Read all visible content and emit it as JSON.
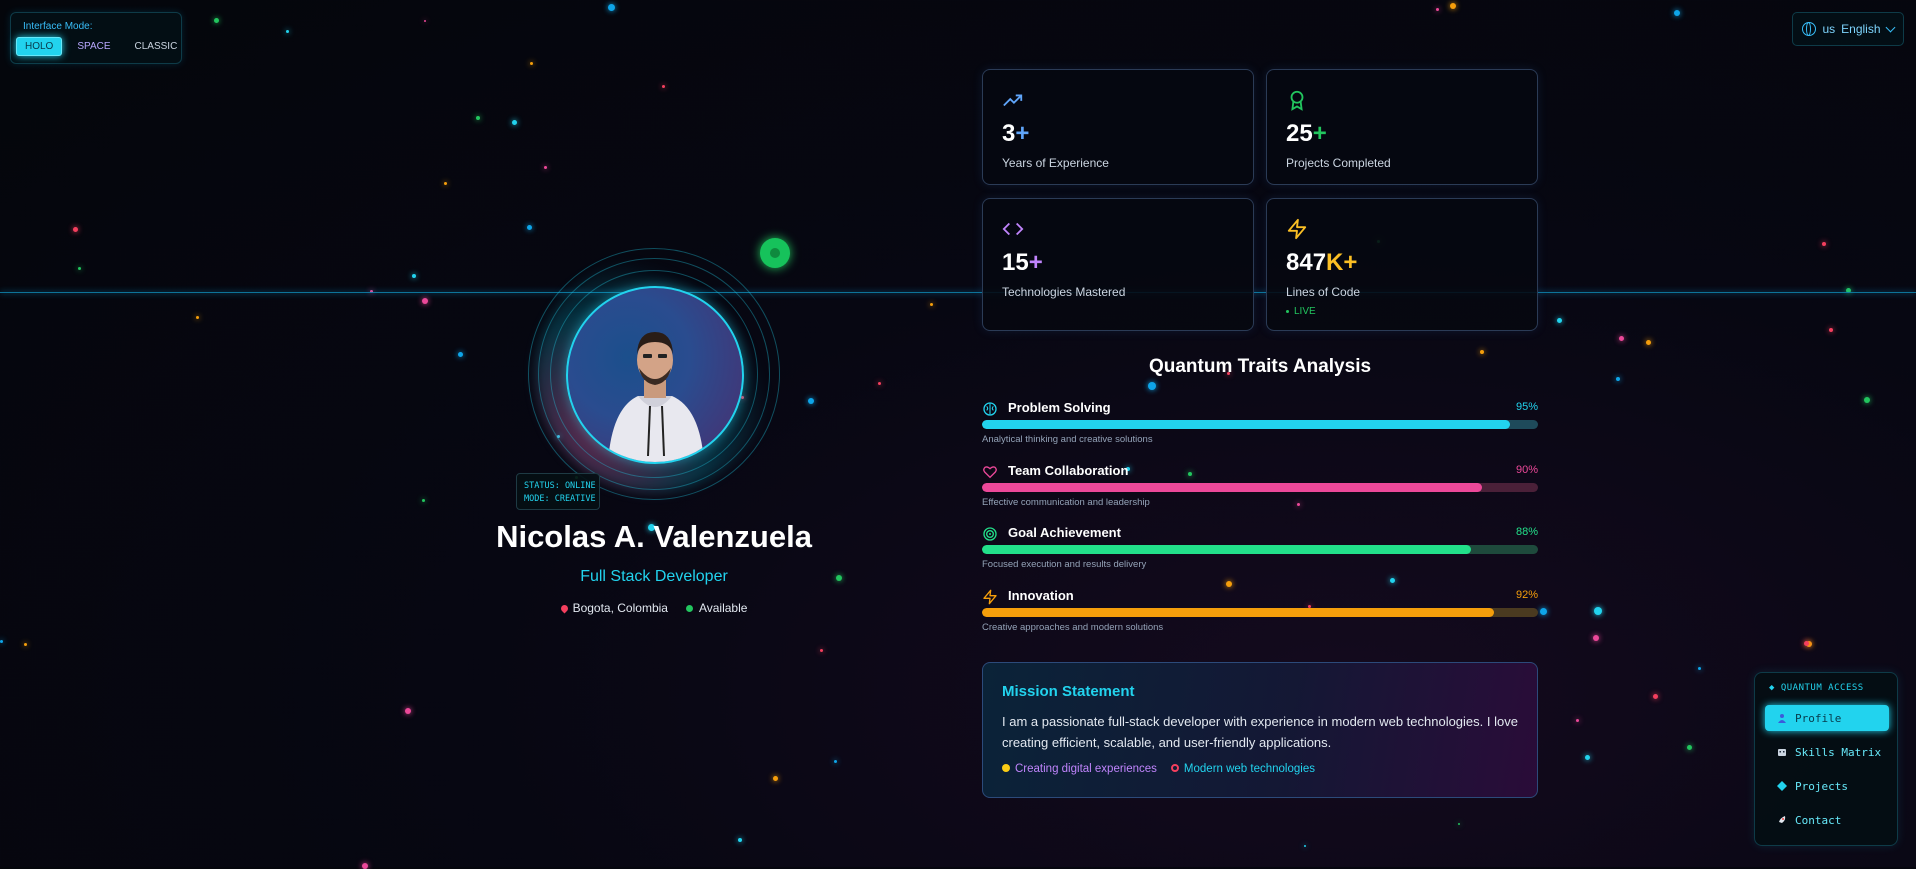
{
  "mode_switch": {
    "title": "Interface Mode:",
    "options": [
      "HOLO",
      "SPACE",
      "CLASSIC"
    ],
    "active": "HOLO"
  },
  "language": {
    "flag": "us",
    "label": "English",
    "icon": "globe-icon"
  },
  "profile": {
    "status_line1": "STATUS: ONLINE",
    "status_line2": "MODE: CREATIVE",
    "name": "Nicolas A. Valenzuela",
    "role": "Full Stack Developer",
    "location": "Bogota, Colombia",
    "availability": "Available"
  },
  "stats": [
    {
      "value": "3",
      "suffix": "+",
      "label": "Years of Experience",
      "icon": "trending-up-icon",
      "color": "#60a5fa"
    },
    {
      "value": "25",
      "suffix": "+",
      "label": "Projects Completed",
      "icon": "award-icon",
      "color": "#22c55e"
    },
    {
      "value": "15",
      "suffix": "+",
      "label": "Technologies Mastered",
      "icon": "code-icon",
      "color": "#c084fc"
    },
    {
      "value": "847",
      "suffix": "K+",
      "label": "Lines of Code",
      "icon": "zap-icon",
      "color": "#fbbf24",
      "live": "LIVE"
    }
  ],
  "traits": {
    "title": "Quantum Traits Analysis",
    "items": [
      {
        "name": "Problem Solving",
        "percent": 95,
        "percent_label": "95%",
        "description": "Analytical thinking and creative solutions",
        "icon": "brain-icon",
        "color": "#22d3ee",
        "track": "#1e4a5a"
      },
      {
        "name": "Team Collaboration",
        "percent": 90,
        "percent_label": "90%",
        "description": "Effective communication and leadership",
        "icon": "heart-icon",
        "color": "#ec4899",
        "track": "#4a2038"
      },
      {
        "name": "Goal Achievement",
        "percent": 88,
        "percent_label": "88%",
        "description": "Focused execution and results delivery",
        "icon": "target-icon",
        "color": "#22e08a",
        "track": "#1e4a3c"
      },
      {
        "name": "Innovation",
        "percent": 92,
        "percent_label": "92%",
        "description": "Creative approaches and modern solutions",
        "icon": "zap-icon",
        "color": "#f59e0b",
        "track": "#4a3a20"
      }
    ]
  },
  "mission": {
    "title": "Mission Statement",
    "body": "I am a passionate full-stack developer with experience in modern web technologies. I love creating efficient, scalable, and user-friendly applications.",
    "tags": [
      "Creating digital experiences",
      "Modern web technologies"
    ]
  },
  "quantum_nav": {
    "title": "◆ QUANTUM ACCESS",
    "items": [
      {
        "label": "Profile",
        "icon": "user-icon"
      },
      {
        "label": "Skills Matrix",
        "icon": "robot-icon"
      },
      {
        "label": "Projects",
        "icon": "diamond-icon"
      },
      {
        "label": "Contact",
        "icon": "rocket-icon"
      }
    ],
    "active": "Profile"
  }
}
